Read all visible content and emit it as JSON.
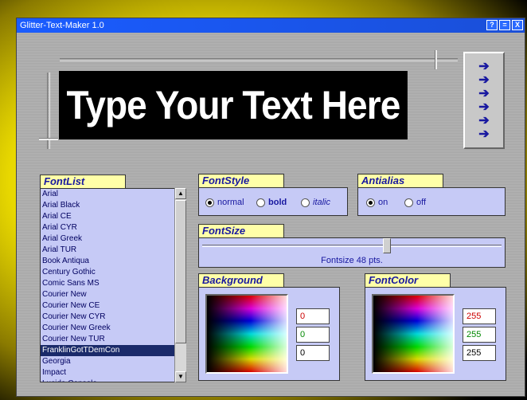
{
  "window": {
    "title": "Glitter-Text-Maker 1.0",
    "buttons": {
      "help": "?",
      "minimize": "=",
      "close": "X"
    }
  },
  "preview": {
    "text": "Type Your Text Here"
  },
  "arrows": [
    "➔",
    "➔",
    "➔",
    "➔",
    "➔",
    "➔"
  ],
  "fontlist": {
    "tab": "FontList",
    "items": [
      "Arial",
      "Arial Black",
      "Arial CE",
      "Arial CYR",
      "Arial Greek",
      "Arial TUR",
      "Book Antiqua",
      "Century Gothic",
      "Comic Sans MS",
      "Courier New",
      "Courier New CE",
      "Courier New CYR",
      "Courier New Greek",
      "Courier New TUR",
      "FranklinGotTDemCon",
      "Georgia",
      "Impact",
      "Lucida Console"
    ],
    "selected": "FranklinGotTDemCon"
  },
  "fontstyle": {
    "tab": "FontStyle",
    "options": [
      {
        "label": "normal",
        "checked": true
      },
      {
        "label": "bold",
        "checked": false
      },
      {
        "label": "italic",
        "checked": false
      }
    ]
  },
  "antialias": {
    "tab": "Antialias",
    "options": [
      {
        "label": "on",
        "checked": true
      },
      {
        "label": "off",
        "checked": false
      }
    ]
  },
  "fontsize": {
    "tab": "FontSize",
    "label": "Fontsize 48 pts.",
    "value_fraction": 0.62
  },
  "background": {
    "tab": "Background",
    "r": "0",
    "g": "0",
    "b": "0",
    "colors": {
      "r": "#cc0000",
      "g": "#008800",
      "b": "#000000"
    }
  },
  "fontcolor": {
    "tab": "FontColor",
    "r": "255",
    "g": "255",
    "b": "255",
    "colors": {
      "r": "#cc0000",
      "g": "#008800",
      "b": "#000000"
    }
  },
  "theme": {
    "accent": "#1818a0",
    "tab_bg": "#ffffa8",
    "panel_bg": "#c6caf6",
    "title_bg": "#1a5cff"
  }
}
